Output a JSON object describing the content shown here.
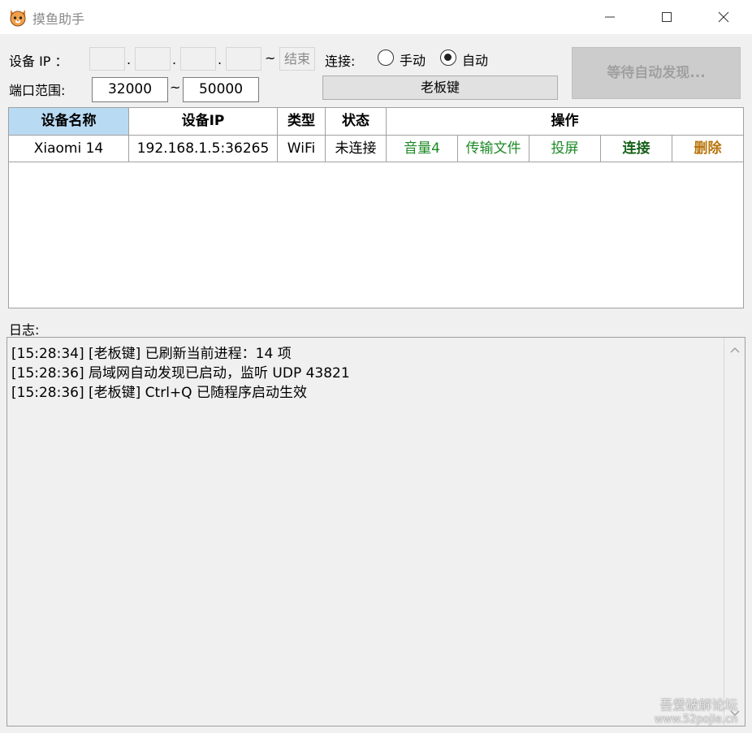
{
  "window": {
    "title": "摸鱼助手"
  },
  "device_ip": {
    "label": "设备  IP ：",
    "octets": [
      "",
      "",
      "",
      ""
    ],
    "dot": ".",
    "tilde": "~",
    "end_label": "结束"
  },
  "connection": {
    "label": "连接:",
    "options": [
      {
        "label": "手动",
        "selected": false
      },
      {
        "label": "自动",
        "selected": true
      }
    ]
  },
  "port_range": {
    "label": "端口范围:",
    "start": "32000",
    "tilde": "~",
    "end": "50000"
  },
  "boss_key_button": "老板键",
  "discover_button": "等待自动发现...",
  "device_table": {
    "headers": [
      "设备名称",
      "设备IP",
      "类型",
      "状态",
      "操作"
    ],
    "rows": [
      {
        "name": "Xiaomi 14",
        "ip": "192.168.1.5:36265",
        "type": "WiFi",
        "status": "未连接",
        "actions": [
          "音量4",
          "传输文件",
          "投屏",
          "连接",
          "删除"
        ]
      }
    ]
  },
  "log": {
    "label": "日志:",
    "lines": [
      "[15:28:34] [老板键] 已刷新当前进程：14 项",
      "[15:28:36] 局域网自动发现已启动，监听 UDP 43821",
      "[15:28:36] [老板键] Ctrl+Q 已随程序启动生效"
    ]
  },
  "watermark": {
    "line1": "吾爱破解论坛",
    "line2": "www.52pojie.cn"
  },
  "colors": {
    "selected_header": "#b9daf3",
    "action_green": "#1d8a26",
    "action_connect": "#17601a",
    "action_delete": "#b7740a"
  }
}
